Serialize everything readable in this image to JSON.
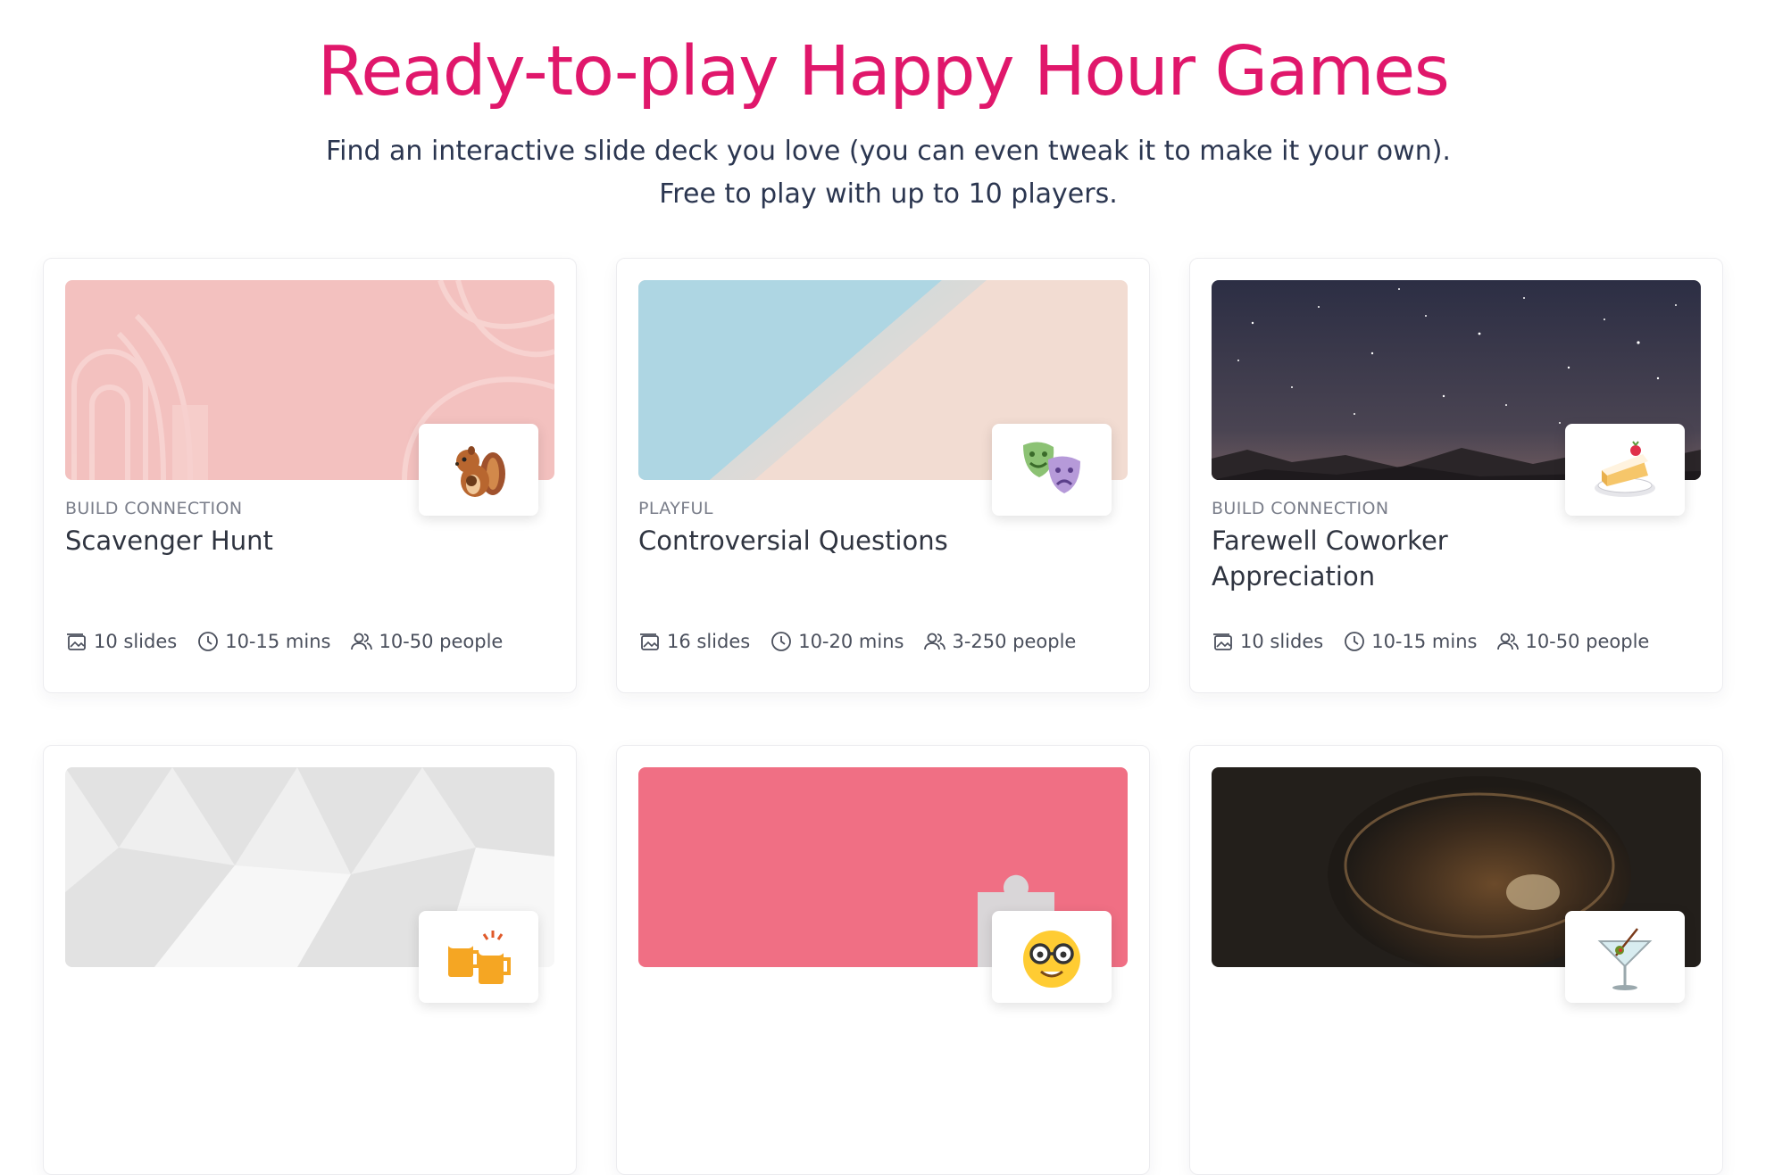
{
  "hero": {
    "title": "Ready-to-play Happy Hour Games",
    "subtitle": "Find an interactive slide deck you love (you can even tweak it to make it your own). Free to play with up to 10 players."
  },
  "cards": [
    {
      "category": "BUILD CONNECTION",
      "title": "Scavenger Hunt",
      "emoji": "chipmunk-icon",
      "slides": "10 slides",
      "duration": "10-15 mins",
      "people": "10-50 people",
      "thumb_color": "#f3c1bf"
    },
    {
      "category": "PLAYFUL",
      "title": "Controversial Questions",
      "emoji": "performing-arts-icon",
      "slides": "16 slides",
      "duration": "10-20 mins",
      "people": "3-250 people",
      "thumb_color": "#f2dcd2"
    },
    {
      "category": "BUILD CONNECTION",
      "title": "Farewell Coworker Appreciation",
      "emoji": "cake-icon",
      "slides": "10 slides",
      "duration": "10-15 mins",
      "people": "10-50 people",
      "thumb_color": "#343448"
    },
    {
      "emoji": "beer-mugs-icon",
      "thumb_color": "#efefef"
    },
    {
      "emoji": "nerd-face-icon",
      "thumb_color": "#f06f84"
    },
    {
      "emoji": "cocktail-icon",
      "thumb_color": "#2a2520"
    }
  ],
  "colors": {
    "accent": "#e0176b",
    "text": "#2b3650"
  }
}
